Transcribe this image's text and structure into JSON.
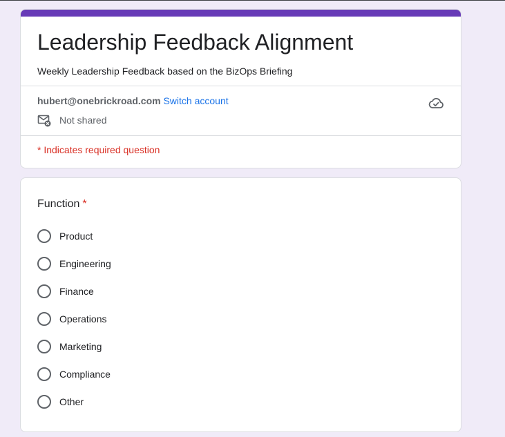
{
  "form": {
    "title": "Leadership Feedback Alignment",
    "description": "Weekly Leadership Feedback based on the BizOps Briefing",
    "accent_color": "#673ab7"
  },
  "account": {
    "email": "hubert@onebrickroad.com",
    "switch_label": "Switch account",
    "shared_status": "Not shared"
  },
  "required_note": "* Indicates required question",
  "question": {
    "title": "Function",
    "required_marker": "*",
    "options": [
      {
        "label": "Product"
      },
      {
        "label": "Engineering"
      },
      {
        "label": "Finance"
      },
      {
        "label": "Operations"
      },
      {
        "label": "Marketing"
      },
      {
        "label": "Compliance"
      },
      {
        "label": "Other"
      }
    ]
  }
}
